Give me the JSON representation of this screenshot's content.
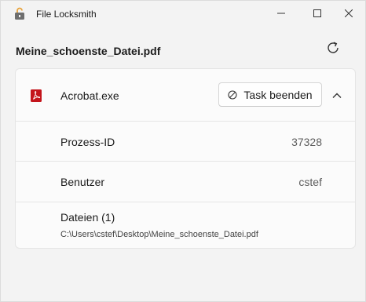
{
  "window": {
    "title": "File Locksmith",
    "minimize_icon": "minimize-icon",
    "maximize_icon": "maximize-icon",
    "close_icon": "close-icon"
  },
  "header": {
    "filename": "Meine_schoenste_Datei.pdf",
    "refresh_icon": "refresh-icon"
  },
  "process": {
    "name": "Acrobat.exe",
    "icon": "pdf-icon",
    "end_task_label": "Task beenden",
    "expanded": true,
    "details": {
      "pid_label": "Prozess-ID",
      "pid_value": "37328",
      "user_label": "Benutzer",
      "user_value": "cstef",
      "files_label": "Dateien (1)",
      "files": [
        "C:\\Users\\cstef\\Desktop\\Meine_schoenste_Datei.pdf"
      ]
    }
  },
  "colors": {
    "background": "#f3f3f3",
    "card": "#fbfbfb",
    "pdf_red": "#c4151c",
    "lock_orange": "#e8a33c"
  }
}
